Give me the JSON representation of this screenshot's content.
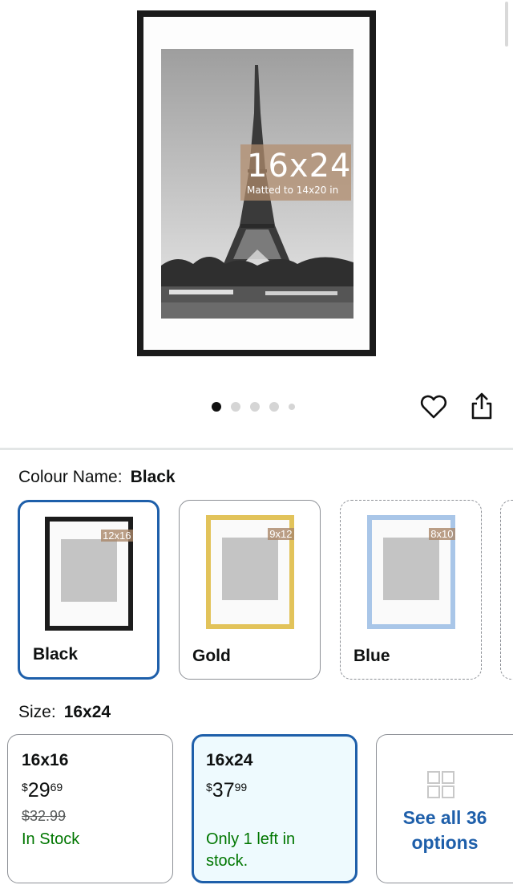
{
  "product_image": {
    "size_overlay": "16x24",
    "matted_overlay": "Matted to 14x20 in",
    "carousel_dots": 5,
    "active_dot": 0
  },
  "actions": {
    "wishlist_icon": "heart-icon",
    "share_icon": "share-icon"
  },
  "colour": {
    "label": "Colour Name:",
    "selected": "Black",
    "options": [
      {
        "name": "Black",
        "frame_color": "#1c1c1c",
        "tag": "12x16",
        "state": "selected"
      },
      {
        "name": "Gold",
        "frame_color": "#e2c35a",
        "tag": "9x12",
        "state": "available"
      },
      {
        "name": "Blue",
        "frame_color": "#a9c6e8",
        "tag": "8x10",
        "state": "unavailable"
      }
    ]
  },
  "size": {
    "label": "Size:",
    "selected": "16x24",
    "options": [
      {
        "title": "16x16",
        "currency": "$",
        "price_whole": "29",
        "price_fraction": "69",
        "was_price": "$32.99",
        "stock": "In Stock"
      },
      {
        "title": "16x24",
        "currency": "$",
        "price_whole": "37",
        "price_fraction": "99",
        "stock_line1": "Only 1 left in",
        "stock_line2": "stock."
      }
    ],
    "see_all_line1": "See all 36",
    "see_all_line2": "options"
  },
  "colors": {
    "selected_border": "#1e5faa",
    "selected_bg": "#eefafe",
    "in_stock": "#007600",
    "link": "#1e5faa"
  }
}
